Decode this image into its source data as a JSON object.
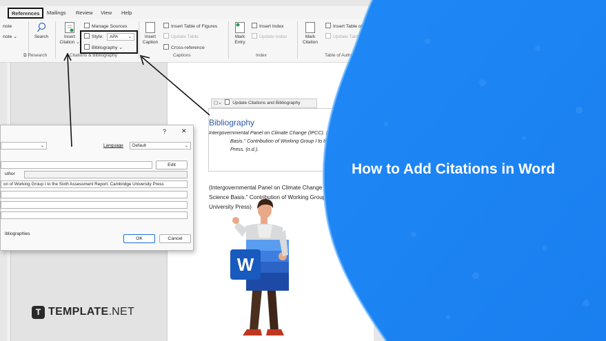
{
  "tabs": [
    "References",
    "Mailings",
    "Review",
    "View",
    "Help"
  ],
  "ribbon": {
    "footnote_partial": "note",
    "footnote_partial2": "note",
    "search": "Search",
    "insert_citation": [
      "Insert",
      "Citation"
    ],
    "manage_sources": "Manage Sources",
    "style_label": "Style:",
    "style_value": "APA",
    "bibliography": "Bibliography",
    "insert_caption": [
      "Insert",
      "Caption"
    ],
    "insert_table_of_figures": "Insert Table of Figures",
    "update_table": "Update Table",
    "cross_reference": "Cross-reference",
    "mark_entry": [
      "Mark",
      "Entry"
    ],
    "insert_index": "Insert Index",
    "update_index": "Update Index",
    "mark_citation": [
      "Mark",
      "Citation"
    ],
    "insert_table_of_authorities": "Insert Table of A",
    "update_table_auth": "Update Table",
    "groups": {
      "research": "Research",
      "citations": "Citations & Bibliography",
      "captions": "Captions",
      "index": "Index",
      "toa": "Table of Authori"
    }
  },
  "document": {
    "bib_toolbar": "Update Citations and Bibliography",
    "bib_heading": "Bibliography",
    "bib_lines": [
      "Intergovernmental Panel on Climate Change (IPCC). (20",
      "Basis.\" Contribution of Working Group I to the",
      "Press. (n.d.)."
    ],
    "body_lines": [
      "(Intergovernmental Panel on Climate Change (IPC",
      "Science Basis.\" Contribution of Working Group I t",
      "University Press)"
    ]
  },
  "dialog": {
    "help": "?",
    "close": "✕",
    "language_label": "Language",
    "language_value": "Default",
    "edit_button": "Edit",
    "author_label": "uthor",
    "title_value": "on of Working Group I to the Sixth Assessment Report. Cambridge University Press",
    "bibliographies": "ibliographies",
    "ok": "OK",
    "cancel": "Cancel"
  },
  "headline": "How to Add Citations in Word",
  "brand": {
    "mark": "T",
    "name_bold": "TEMPLATE",
    "name_rest": ".NET"
  },
  "colors": {
    "blue_panel": "#1a86f5",
    "blue_light": "#3d9cf8",
    "word_blue": "#185abd",
    "heading_blue": "#2e5a9c"
  }
}
